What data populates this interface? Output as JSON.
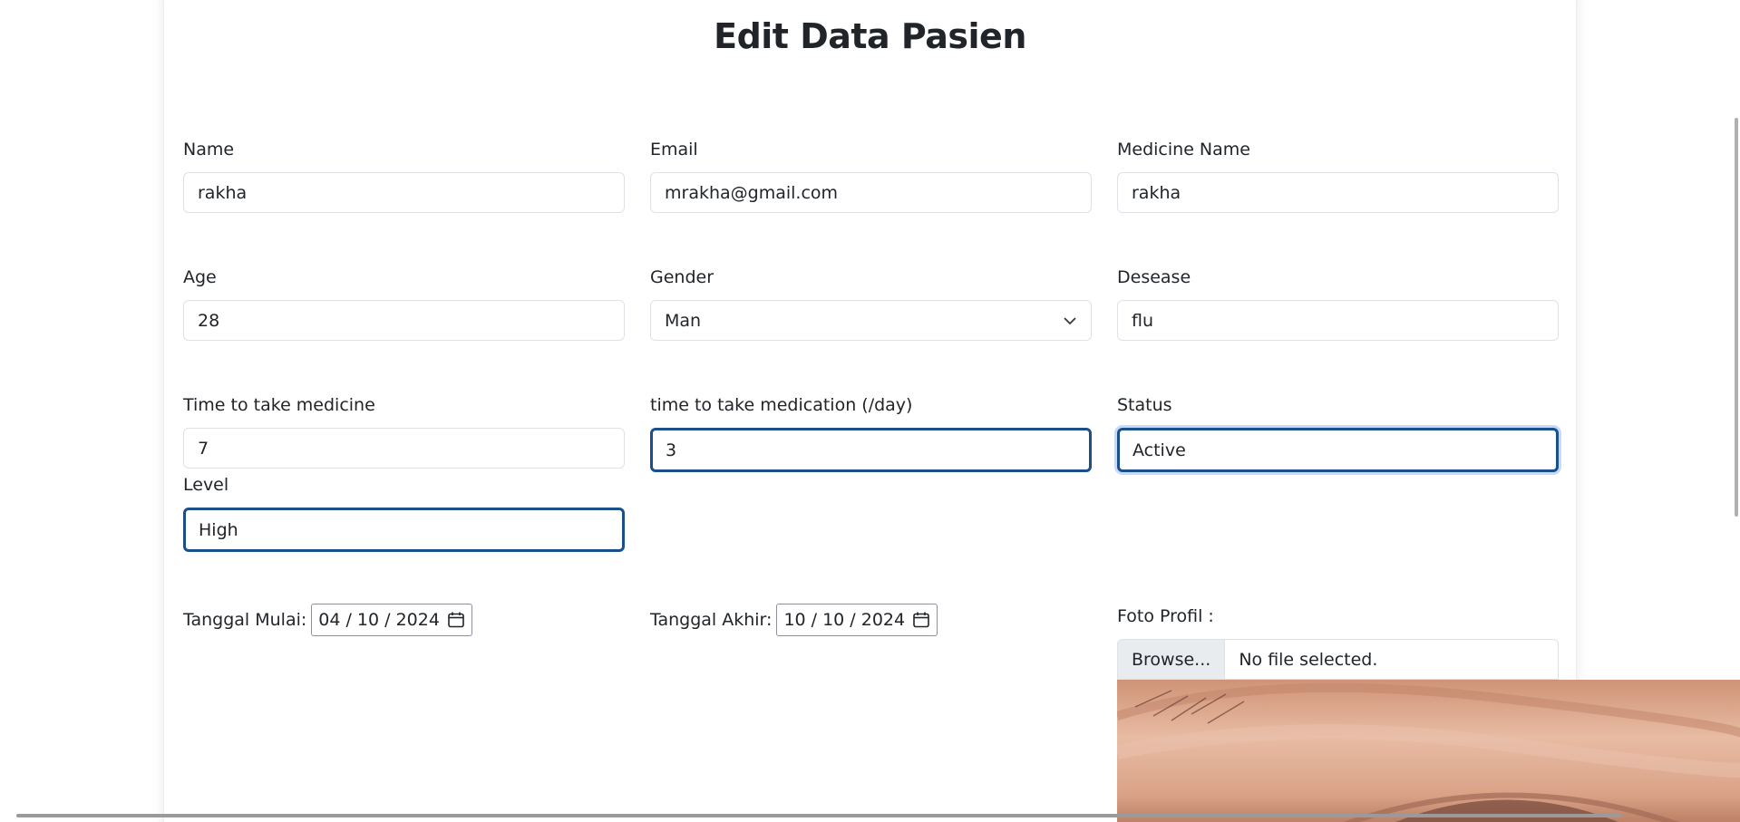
{
  "title": "Edit Data Pasien",
  "fields": {
    "name": {
      "label": "Name",
      "value": "rakha"
    },
    "email": {
      "label": "Email",
      "value": "mrakha@gmail.com"
    },
    "medicine_name": {
      "label": "Medicine Name",
      "value": "rakha"
    },
    "age": {
      "label": "Age",
      "value": "28"
    },
    "gender": {
      "label": "Gender",
      "value": "Man"
    },
    "desease": {
      "label": "Desease",
      "value": "flu"
    },
    "time_to_take_medicine": {
      "label": "Time to take medicine",
      "value": "7"
    },
    "time_per_day": {
      "label": "time to take medication (/day)",
      "value": "3"
    },
    "status": {
      "label": "Status",
      "value": "Active"
    },
    "level": {
      "label": "Level",
      "value": "High"
    }
  },
  "dates": {
    "start": {
      "label": "Tanggal Mulai:",
      "value": "04 / 10 / 2024"
    },
    "end": {
      "label": "Tanggal Akhir:",
      "value": "10 / 10 / 2024"
    }
  },
  "photo": {
    "label": "Foto Profil :",
    "browse_label": "Browse...",
    "file_status": "No file selected."
  },
  "icons": {
    "gender_dropdown": "chevron-down-icon",
    "date_picker": "calendar-icon"
  },
  "colors": {
    "focus_border": "#1b4f8a",
    "field_border": "#dee2e6",
    "text": "#212529"
  }
}
